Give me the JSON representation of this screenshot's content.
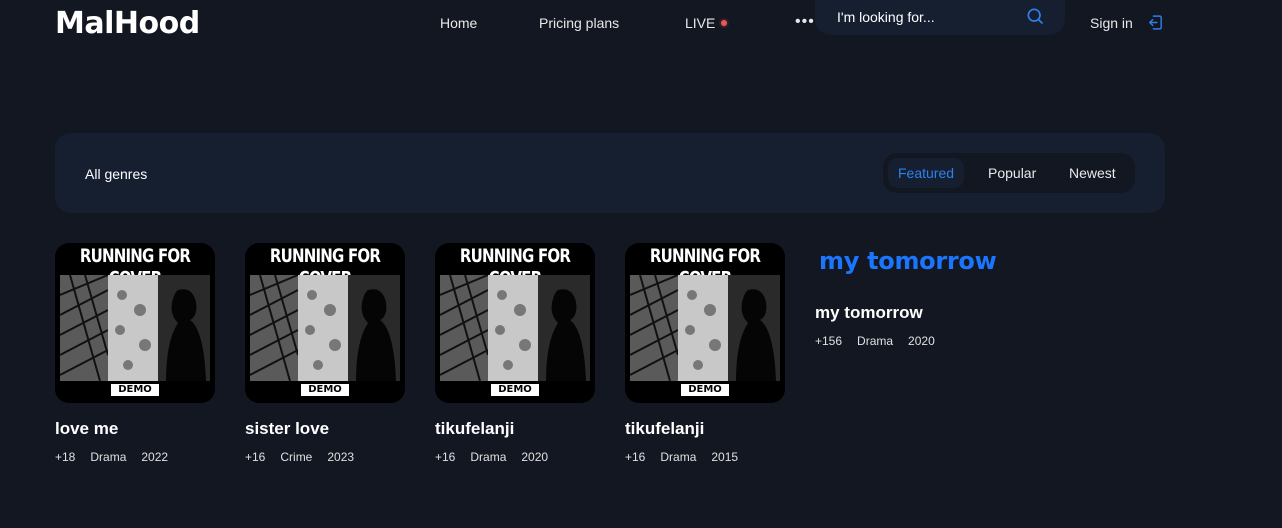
{
  "header": {
    "logo": "MalHood",
    "nav": [
      {
        "label": "Home"
      },
      {
        "label": "Pricing plans"
      },
      {
        "label": "LIVE"
      }
    ],
    "more": "•••",
    "search_placeholder": "I'm looking for...",
    "signin": "Sign in"
  },
  "filter": {
    "genres": "All genres",
    "tabs": [
      {
        "label": "Featured",
        "active": true
      },
      {
        "label": "Popular",
        "active": false
      },
      {
        "label": "Newest",
        "active": false
      }
    ]
  },
  "cover": {
    "headline": "RUNNING FOR COVER",
    "badge": "DEMO"
  },
  "items": [
    {
      "title": "love me",
      "age": "+18",
      "genre": "Drama",
      "year": "2022"
    },
    {
      "title": "sister love",
      "age": "+16",
      "genre": "Crime",
      "year": "2023"
    },
    {
      "title": "tikufelanji",
      "age": "+16",
      "genre": "Drama",
      "year": "2020"
    },
    {
      "title": "tikufelanji",
      "age": "+16",
      "genre": "Drama",
      "year": "2015"
    },
    {
      "hero_text": "my tomorrow",
      "title": "my tomorrow",
      "age": "+156",
      "genre": "Drama",
      "year": "2020"
    }
  ],
  "colors": {
    "background": "#131722",
    "panel": "#151f30",
    "accent": "#2f80ed",
    "live": "#eb5757"
  }
}
